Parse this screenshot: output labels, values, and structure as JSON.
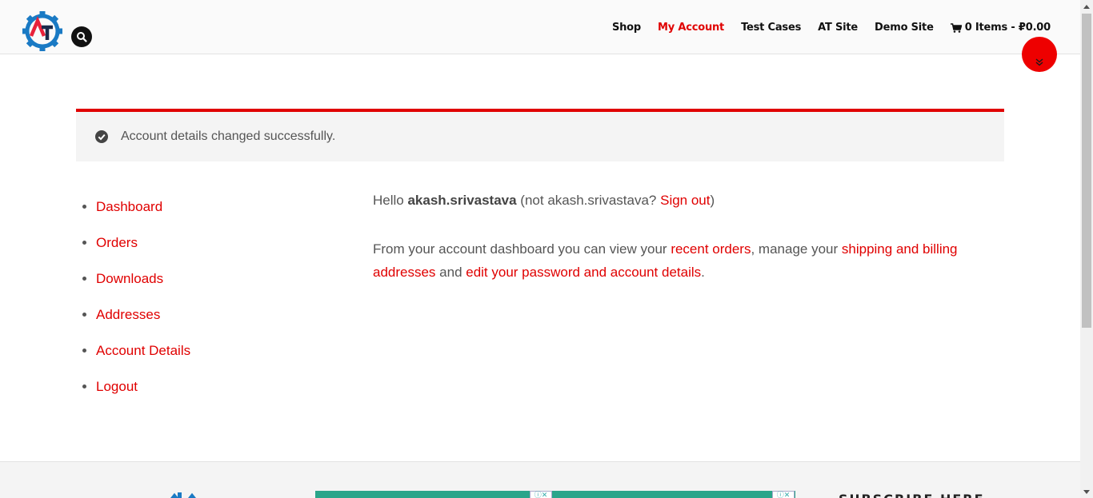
{
  "header": {
    "nav": {
      "shop": "Shop",
      "my_account": "My Account",
      "test_cases": "Test Cases",
      "at_site": "AT Site",
      "demo_site": "Demo Site",
      "cart": "0 Items - ₽0.00"
    }
  },
  "notice": {
    "message": "Account details changed successfully."
  },
  "menu": {
    "items": [
      {
        "label": "Dashboard"
      },
      {
        "label": "Orders"
      },
      {
        "label": "Downloads"
      },
      {
        "label": "Addresses"
      },
      {
        "label": "Account Details"
      },
      {
        "label": "Logout"
      }
    ]
  },
  "content": {
    "hello": "Hello ",
    "username": "akash.srivastava",
    "not_prefix": " (not akash.srivastava? ",
    "sign_out": "Sign out",
    "not_suffix": ")",
    "intro": "From your account dashboard you can view your ",
    "recent_orders": "recent orders",
    "manage": ", manage your ",
    "shipping_billing": "shipping and billing addresses",
    "and": " and ",
    "edit_password": "edit your password and account details",
    "period": "."
  },
  "footer": {
    "subscribe": "SUBSCRIBE HERE"
  },
  "colors": {
    "accent": "#e00000",
    "logo_blue": "#1a7ac4",
    "logo_red": "#e8213a"
  }
}
